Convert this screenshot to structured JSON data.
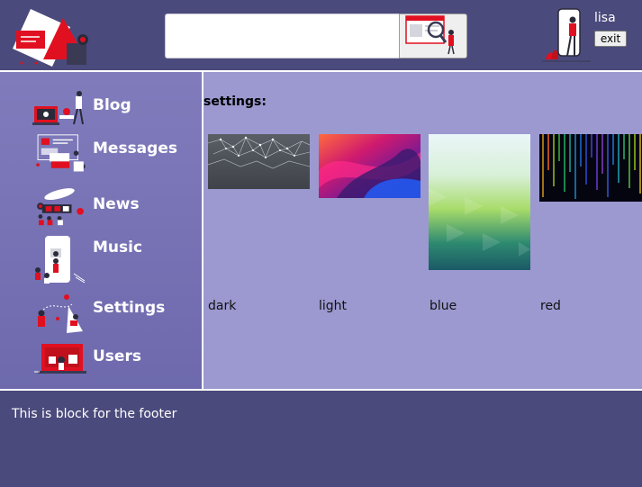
{
  "header": {
    "search": {
      "value": "",
      "placeholder": ""
    },
    "user": {
      "name": "lisa",
      "exit_label": "exit"
    }
  },
  "sidebar": {
    "items": [
      {
        "label": "Blog"
      },
      {
        "label": "Messages"
      },
      {
        "label": "News"
      },
      {
        "label": "Music"
      },
      {
        "label": "Settings"
      },
      {
        "label": "Users"
      }
    ]
  },
  "main": {
    "title": "settings:",
    "themes": [
      {
        "label": "dark"
      },
      {
        "label": "light"
      },
      {
        "label": "blue"
      },
      {
        "label": "red"
      }
    ]
  },
  "footer": {
    "text": "This is block for the footer"
  },
  "colors": {
    "header_bg": "#4b4a7c",
    "sidebar_bg": "#7571b4",
    "main_bg": "#9b99cf",
    "accent_red": "#e01020"
  }
}
